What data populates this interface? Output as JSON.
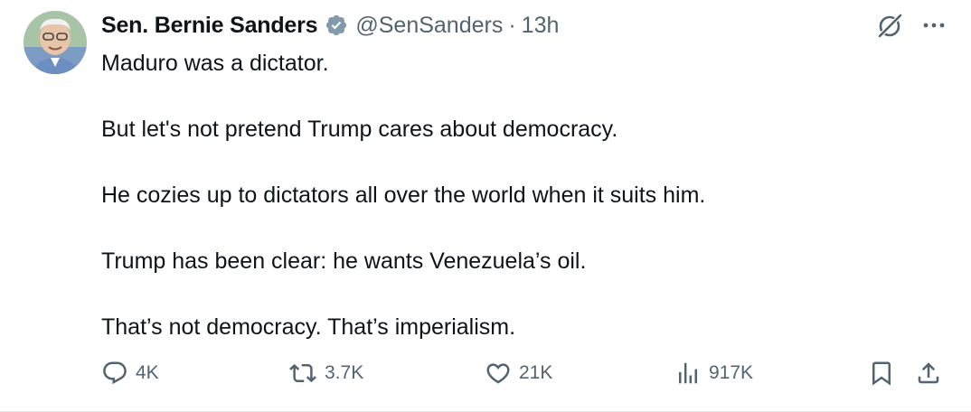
{
  "author": {
    "name": "Sen. Bernie Sanders",
    "handle": "@SenSanders",
    "separator": "·",
    "time": "13h"
  },
  "tweet": {
    "paragraphs": [
      "Maduro was a dictator.",
      "But let's not pretend Trump cares about democracy.",
      "He cozies up to dictators all over the world when it suits him.",
      "Trump has been clear: he wants Venezuela’s oil.",
      "That’s not democracy. That’s imperialism."
    ]
  },
  "stats": {
    "replies": "4K",
    "reposts": "3.7K",
    "likes": "21K",
    "views": "917K"
  },
  "icons": {
    "verified": "verified-badge-icon",
    "grok": "grok-icon",
    "more": "more-icon",
    "reply": "reply-icon",
    "repost": "repost-icon",
    "like": "heart-icon",
    "views": "views-icon",
    "bookmark": "bookmark-icon",
    "share": "share-icon"
  },
  "colors": {
    "text": "#0f1419",
    "secondary": "#536471",
    "badge": "#829aab"
  }
}
